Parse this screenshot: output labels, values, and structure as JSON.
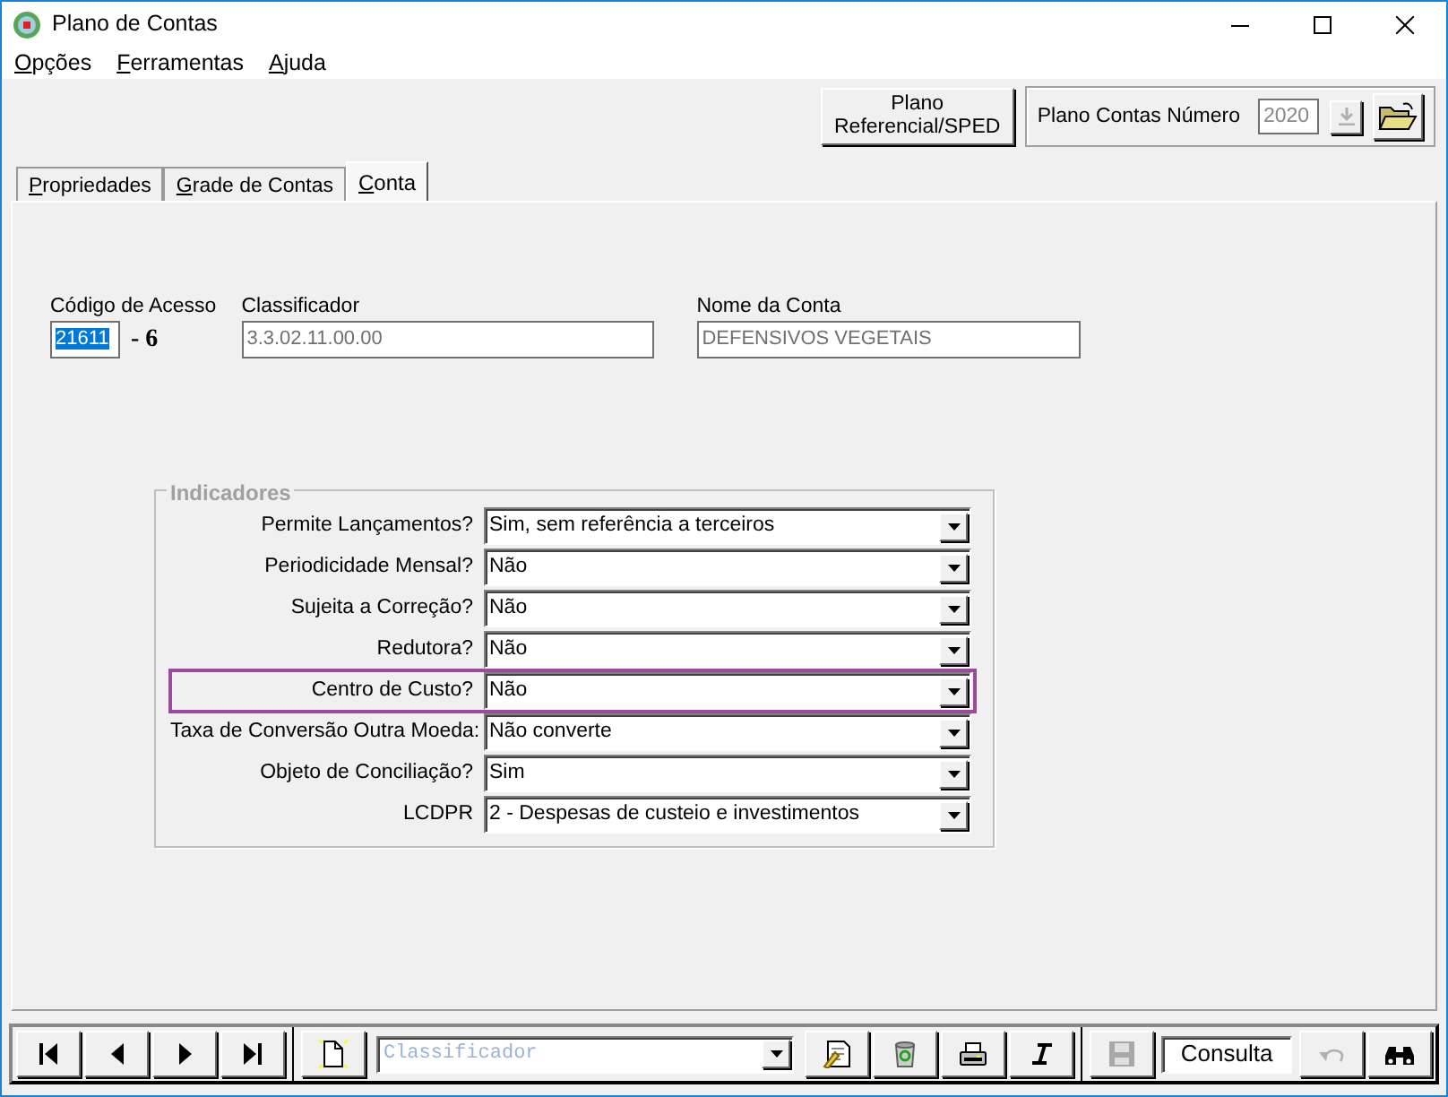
{
  "window": {
    "title": "Plano de Contas"
  },
  "menu": [
    {
      "label": "Opções"
    },
    {
      "label": "Ferramentas"
    },
    {
      "label": "Ajuda"
    }
  ],
  "toolbar": {
    "referencial_button": "Plano Referencial/SPED",
    "plan_label": "Plano Contas Número",
    "plan_value": "2020",
    "plan_spin_disabled": true
  },
  "tabs": [
    {
      "label": "Propriedades",
      "selected": false
    },
    {
      "label": "Grade de Contas",
      "selected": false
    },
    {
      "label": "Conta",
      "selected": true
    }
  ],
  "account": {
    "code_label": "Código de Acesso",
    "code": "21611",
    "code_selected": true,
    "digit": "- 6",
    "classifier_label": "Classificador",
    "classifier": "3.3.02.11.00.00",
    "name_label": "Nome da Conta",
    "name": "DEFENSIVOS VEGETAIS"
  },
  "indicators": {
    "title": "Indicadores",
    "rows": [
      {
        "label": "Permite Lançamentos?",
        "value": "Sim, sem referência a terceiros",
        "highlighted": false
      },
      {
        "label": "Periodicidade Mensal?",
        "value": "Não",
        "highlighted": false
      },
      {
        "label": "Sujeita a Correção?",
        "value": "Não",
        "highlighted": false
      },
      {
        "label": "Redutora?",
        "value": "Não",
        "highlighted": false
      },
      {
        "label": "Centro de Custo?",
        "value": "Não",
        "highlighted": true
      },
      {
        "label": "Taxa de Conversão Outra Moeda:",
        "value": "Não converte",
        "highlighted": false
      },
      {
        "label": "Objeto de Conciliação?",
        "value": "Sim",
        "highlighted": false
      },
      {
        "label": "LCDPR",
        "value": "2 - Despesas de custeio e investimentos",
        "highlighted": false
      }
    ]
  },
  "bottom_bar": {
    "search_placeholder": "Classificador",
    "mode": "Consulta",
    "save_disabled": true,
    "undo_disabled": true
  }
}
